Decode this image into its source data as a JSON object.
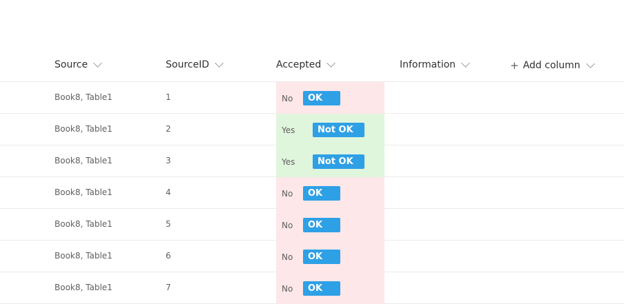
{
  "columns": [
    "Source",
    "SourceID",
    "Accepted",
    "Information",
    "Add column"
  ],
  "rows": [
    {
      "source": "Book8, Table1",
      "id": "1",
      "accepted": "No",
      "button": "OK"
    },
    {
      "source": "Book8, Table1",
      "id": "2",
      "accepted": "Yes",
      "button": "Not OK"
    },
    {
      "source": "Book8, Table1",
      "id": "3",
      "accepted": "Yes",
      "button": "Not OK"
    },
    {
      "source": "Book8, Table1",
      "id": "4",
      "accepted": "No",
      "button": "OK"
    },
    {
      "source": "Book8, Table1",
      "id": "5",
      "accepted": "No",
      "button": "OK"
    },
    {
      "source": "Book8, Table1",
      "id": "6",
      "accepted": "No",
      "button": "OK"
    },
    {
      "source": "Book8, Table1",
      "id": "7",
      "accepted": "No",
      "button": "OK"
    }
  ],
  "colors": {
    "no_bg": "#fde7e9",
    "yes_bg": "#dff6dd",
    "button": "#2ea0e6"
  }
}
